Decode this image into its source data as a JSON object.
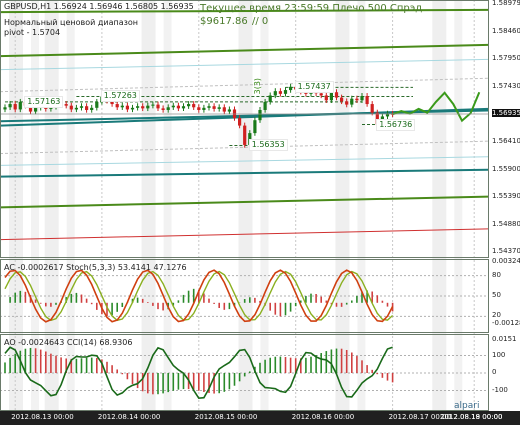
{
  "header": {
    "symbol_line": "GBPUSD,H1  1.56924  1.56946  1.56805  1.56935",
    "line2": "Нормальный ценовой диапазон",
    "line3": "pivot - 1.5704"
  },
  "overlay": {
    "server_time": "Текущее время 23:59:59 Плечо 500 Спрэд",
    "balance": "$9617.86",
    "balance_suffix": "// 0"
  },
  "price_axis": [
    {
      "label": "1.58979",
      "value": 1.58979
    },
    {
      "label": "1.58460",
      "value": 1.5846
    },
    {
      "label": "1.57950",
      "value": 1.5795
    },
    {
      "label": "1.57430",
      "value": 1.5743
    },
    {
      "label": "1.56935",
      "value": 1.56935,
      "current": true
    },
    {
      "label": "1.56410",
      "value": 1.5641
    },
    {
      "label": "1.55900",
      "value": 1.559
    },
    {
      "label": "1.55390",
      "value": 1.5539
    },
    {
      "label": "1.54880",
      "value": 1.5488
    },
    {
      "label": "1.54370",
      "value": 1.5437
    }
  ],
  "level_tags": [
    {
      "text": "1.57163",
      "value": 1.57163,
      "bar": 3
    },
    {
      "text": "1.57263",
      "value": 1.57263,
      "bar": 18
    },
    {
      "text": "1.56353",
      "value": 1.56353,
      "bar": 47
    },
    {
      "text": "1.57437",
      "value": 1.57437,
      "bar": 56
    },
    {
      "text": "1.56736",
      "value": 1.56736,
      "bar": 72
    }
  ],
  "wave_label": "3(3)",
  "ac_pane": {
    "label": "AC -0.0002617  Stoch(5,3,3) 53.4141 47.1276",
    "axis": [
      {
        "label": "0.00324",
        "value": 0.00324
      },
      {
        "label": "80",
        "value": 80
      },
      {
        "label": "50",
        "value": 50
      },
      {
        "label": "20",
        "value": 20
      },
      {
        "label": "-0.00128",
        "value": -0.00128
      }
    ]
  },
  "ao_pane": {
    "label": "AO -0.0024643  CCI(14) 68.9306",
    "axis": [
      {
        "label": "0.0151",
        "value": 0.0151
      },
      {
        "label": "100",
        "value": 100
      },
      {
        "label": "0",
        "value": 0
      },
      {
        "label": "-100",
        "value": -100
      }
    ]
  },
  "time_axis": [
    {
      "label": "2012.08.13 00:00",
      "bar": 2
    },
    {
      "label": "2012.08.14 00:00",
      "bar": 19
    },
    {
      "label": "2012.08.15 00:00",
      "bar": 38
    },
    {
      "label": "2012.08.16 00:00",
      "bar": 57
    },
    {
      "label": "2012.08.17 00:00",
      "bar": 76
    },
    {
      "label": "2012.08.18 00:00",
      "bar": 92
    },
    {
      "label": "2012.08.19 00:00",
      "bar": 110
    }
  ],
  "logo": "alpari",
  "colors": {
    "bull_candle": "#1a7a1a",
    "bear_candle": "#d02020",
    "channel_green": "#4a8a1a",
    "channel_teal": "#1a7a7a",
    "channel_red": "#d03030",
    "forecast": "#3a9a1a",
    "stoch_main": "#d04010",
    "stoch_signal": "#8ab020",
    "cci": "#1a6a1a",
    "ac_up": "#2a8a2a",
    "ac_down": "#d04040",
    "time_axis_bg": "#202020"
  },
  "chart_data": {
    "type": "candlestick",
    "symbol": "GBPUSD",
    "timeframe": "H1",
    "ylim": [
      1.5437,
      1.5898
    ],
    "last": {
      "open": 1.56924,
      "high": 1.56946,
      "low": 1.56805,
      "close": 1.56935
    },
    "closes": [
      1.5706,
      1.5712,
      1.5702,
      1.5716,
      1.5709,
      1.5698,
      1.5705,
      1.5711,
      1.5703,
      1.5707,
      1.5714,
      1.5712,
      1.5709,
      1.5702,
      1.5705,
      1.5708,
      1.5701,
      1.5705,
      1.5716,
      1.5726,
      1.5718,
      1.5712,
      1.5706,
      1.5709,
      1.5702,
      1.5705,
      1.5708,
      1.5704,
      1.5709,
      1.5711,
      1.5704,
      1.5701,
      1.5706,
      1.5709,
      1.5704,
      1.5708,
      1.5712,
      1.5706,
      1.5701,
      1.5705,
      1.5708,
      1.5703,
      1.5706,
      1.5698,
      1.5702,
      1.5686,
      1.5672,
      1.5636,
      1.5658,
      1.5682,
      1.5701,
      1.5716,
      1.5728,
      1.5736,
      1.5731,
      1.5738,
      1.5744,
      1.5739,
      1.5735,
      1.5731,
      1.5736,
      1.5732,
      1.5728,
      1.5719,
      1.5734,
      1.5724,
      1.5717,
      1.5711,
      1.5722,
      1.5719,
      1.5727,
      1.5712,
      1.5696,
      1.5674,
      1.5689,
      1.5694,
      1.5693
    ],
    "forecast": [
      1.5693,
      1.5699,
      1.5694,
      1.5703,
      1.5696,
      1.5716,
      1.5733,
      1.5712,
      1.5681,
      1.5695,
      1.5734
    ]
  }
}
